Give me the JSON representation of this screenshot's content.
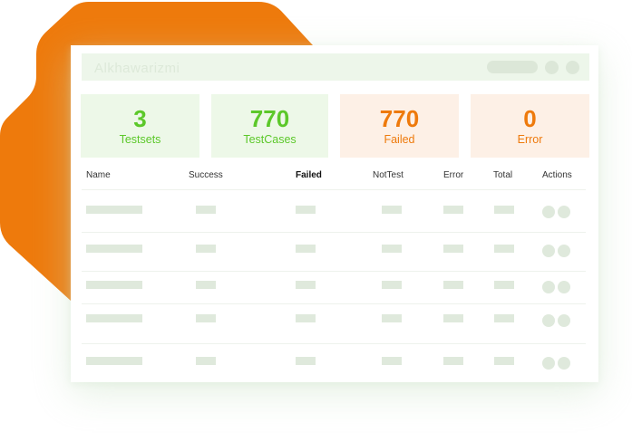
{
  "app": {
    "title": "Alkhawarizmi"
  },
  "colors": {
    "brand_orange": "#ee7a0c",
    "success_green": "#5cc82a",
    "card_green_bg": "#edf8e8",
    "card_orange_bg": "#fdf0e6",
    "placeholder": "#dfe9dc"
  },
  "stats": [
    {
      "value": "3",
      "label": "Testsets",
      "tone": "green"
    },
    {
      "value": "770",
      "label": "TestCases",
      "tone": "green"
    },
    {
      "value": "770",
      "label": "Failed",
      "tone": "orange"
    },
    {
      "value": "0",
      "label": "Error",
      "tone": "orange"
    }
  ],
  "table": {
    "columns": [
      "Name",
      "Success",
      "Failed",
      "NotTest",
      "Error",
      "Total",
      "Actions"
    ],
    "highlighted_column": "Failed",
    "row_count": 5
  },
  "icons": {
    "titlebar_controls": [
      "window-control-icon",
      "window-control-icon"
    ],
    "row_actions": [
      "action-icon",
      "action-icon"
    ]
  }
}
